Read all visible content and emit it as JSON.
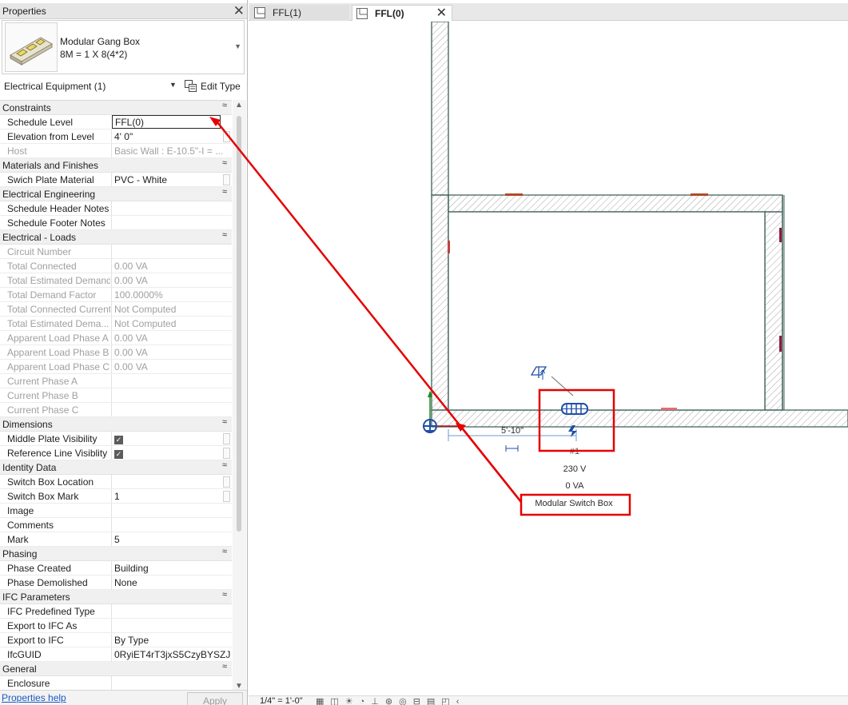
{
  "properties": {
    "title": "Properties",
    "close_glyph": "✕",
    "type_family": "Modular Gang Box",
    "type_name": "8M = 1 X 8(4*2)",
    "category_filter": "Electrical Equipment (1)",
    "edit_type_label": "Edit Type",
    "groups": [
      {
        "label": "Constraints",
        "rows": [
          {
            "name": "Schedule Level",
            "value": "FFL(0)",
            "editing": true
          },
          {
            "name": "Elevation from Level",
            "value": "4'  0\"",
            "button": true
          },
          {
            "name": "Host",
            "value": "Basic Wall : E-10.5\"-I = ...",
            "disabled": true
          }
        ]
      },
      {
        "label": "Materials and Finishes",
        "rows": [
          {
            "name": "Swich Plate Material",
            "value": "PVC - White",
            "button": true
          }
        ]
      },
      {
        "label": "Electrical Engineering",
        "rows": [
          {
            "name": "Schedule Header Notes",
            "value": ""
          },
          {
            "name": "Schedule Footer Notes",
            "value": ""
          }
        ]
      },
      {
        "label": "Electrical - Loads",
        "rows": [
          {
            "name": "Circuit Number",
            "value": "",
            "disabled": true
          },
          {
            "name": "Total Connected",
            "value": "0.00 VA",
            "disabled": true
          },
          {
            "name": "Total Estimated Demand",
            "value": "0.00 VA",
            "disabled": true
          },
          {
            "name": "Total Demand Factor",
            "value": "100.0000%",
            "disabled": true
          },
          {
            "name": "Total Connected Current",
            "value": "Not Computed",
            "disabled": true
          },
          {
            "name": "Total Estimated Dema...",
            "value": "Not Computed",
            "disabled": true
          },
          {
            "name": "Apparent Load Phase A",
            "value": "0.00 VA",
            "disabled": true
          },
          {
            "name": "Apparent Load Phase B",
            "value": "0.00 VA",
            "disabled": true
          },
          {
            "name": "Apparent Load Phase C",
            "value": "0.00 VA",
            "disabled": true
          },
          {
            "name": "Current Phase A",
            "value": "",
            "disabled": true
          },
          {
            "name": "Current Phase B",
            "value": "",
            "disabled": true
          },
          {
            "name": "Current Phase C",
            "value": "",
            "disabled": true
          }
        ]
      },
      {
        "label": "Dimensions",
        "rows": [
          {
            "name": "Middle Plate Visibility",
            "checked": true,
            "button": true
          },
          {
            "name": "Reference Line Visiblity",
            "checked": true,
            "button": true
          }
        ]
      },
      {
        "label": "Identity Data",
        "rows": [
          {
            "name": "Switch Box Location",
            "value": "",
            "button": true
          },
          {
            "name": "Switch Box Mark",
            "value": "1",
            "button": true
          },
          {
            "name": "Image",
            "value": ""
          },
          {
            "name": "Comments",
            "value": ""
          },
          {
            "name": "Mark",
            "value": "5"
          }
        ]
      },
      {
        "label": "Phasing",
        "rows": [
          {
            "name": "Phase Created",
            "value": "Building"
          },
          {
            "name": "Phase Demolished",
            "value": "None"
          }
        ]
      },
      {
        "label": "IFC Parameters",
        "rows": [
          {
            "name": "IFC Predefined Type",
            "value": ""
          },
          {
            "name": "Export to IFC As",
            "value": ""
          },
          {
            "name": "Export to IFC",
            "value": "By Type"
          },
          {
            "name": "IfcGUID",
            "value": "0RyiET4rT3jxS5CzyBYSZJ"
          }
        ]
      },
      {
        "label": "General",
        "rows": [
          {
            "name": "Enclosure",
            "value": ""
          }
        ]
      }
    ],
    "collapse_glyph": "≈",
    "help_link": "Properties help",
    "apply_label": "Apply"
  },
  "tabs": [
    {
      "label": "FFL(1)",
      "active": false
    },
    {
      "label": "FFL(0)",
      "active": true
    }
  ],
  "tab_close_glyph": "✕",
  "canvas": {
    "dimension_label": "5'-10\"",
    "tag_id": "#1",
    "voltage": "230 V",
    "load": "0 VA",
    "tag_name": "Modular Switch Box"
  },
  "view_control_bar": {
    "scale": "1/4\" = 1'-0\"",
    "icons": "▦◫☀◔⊥⊛◎⊟▤◰‹"
  },
  "colors": {
    "wall_hatch": "#9a9a9a",
    "wall_outline": "#3d5e58",
    "selection_blue": "#1f4ea8",
    "annotation_red": "#e60000"
  }
}
